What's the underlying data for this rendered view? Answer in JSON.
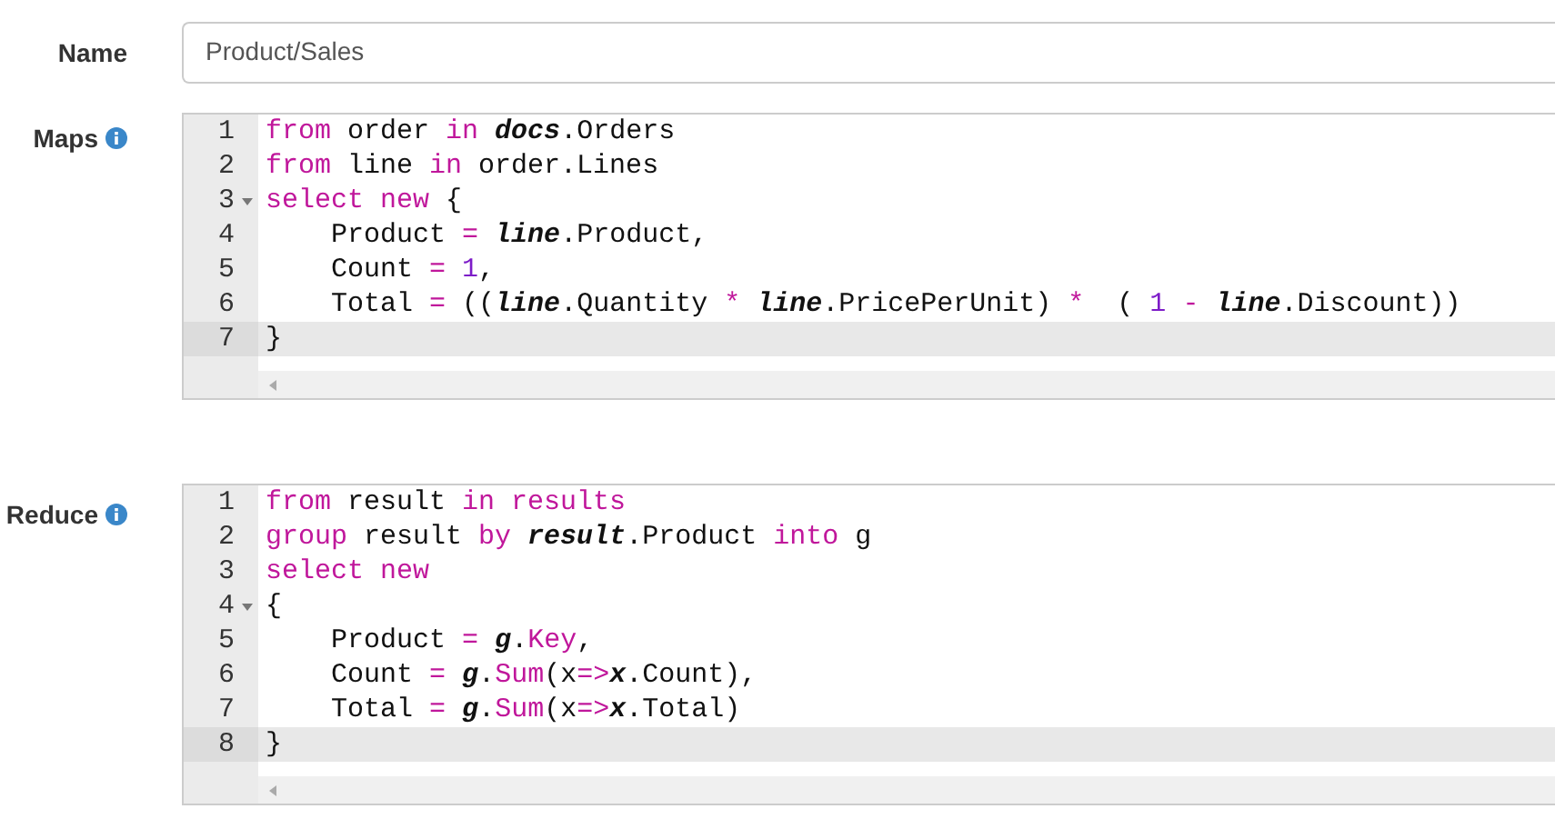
{
  "name_field": {
    "label": "Name",
    "value": "Product/Sales"
  },
  "editors": [
    {
      "label": "Maps",
      "lines": [
        {
          "number": "1",
          "fold": false,
          "current": false,
          "tokens": [
            {
              "t": "from",
              "kind": "kw"
            },
            {
              "t": " order ",
              "kind": "text"
            },
            {
              "t": "in ",
              "kind": "kw"
            },
            {
              "t": "docs",
              "kind": "var"
            },
            {
              "t": ".Orders",
              "kind": "text"
            }
          ]
        },
        {
          "number": "2",
          "fold": false,
          "current": false,
          "tokens": [
            {
              "t": "from",
              "kind": "kw"
            },
            {
              "t": " line ",
              "kind": "text"
            },
            {
              "t": "in",
              "kind": "kw"
            },
            {
              "t": " order.Lines",
              "kind": "text"
            }
          ]
        },
        {
          "number": "3",
          "fold": true,
          "current": false,
          "tokens": [
            {
              "t": "select new",
              "kind": "kw"
            },
            {
              "t": " {",
              "kind": "text"
            }
          ]
        },
        {
          "number": "4",
          "fold": false,
          "current": false,
          "tokens": [
            {
              "t": "    Product ",
              "kind": "text"
            },
            {
              "t": "= ",
              "kind": "op"
            },
            {
              "t": "line",
              "kind": "var"
            },
            {
              "t": ".Product,",
              "kind": "text"
            }
          ]
        },
        {
          "number": "5",
          "fold": false,
          "current": false,
          "tokens": [
            {
              "t": "    Count ",
              "kind": "text"
            },
            {
              "t": "= ",
              "kind": "op"
            },
            {
              "t": "1",
              "kind": "num"
            },
            {
              "t": ",",
              "kind": "text"
            }
          ]
        },
        {
          "number": "6",
          "fold": false,
          "current": false,
          "tokens": [
            {
              "t": "    Total ",
              "kind": "text"
            },
            {
              "t": "=",
              "kind": "op"
            },
            {
              "t": " ((",
              "kind": "text"
            },
            {
              "t": "line",
              "kind": "var"
            },
            {
              "t": ".Quantity ",
              "kind": "text"
            },
            {
              "t": "* ",
              "kind": "op"
            },
            {
              "t": "line",
              "kind": "var"
            },
            {
              "t": ".PricePerUnit) ",
              "kind": "text"
            },
            {
              "t": "*",
              "kind": "op"
            },
            {
              "t": "  ( ",
              "kind": "text"
            },
            {
              "t": "1 ",
              "kind": "num"
            },
            {
              "t": "- ",
              "kind": "op"
            },
            {
              "t": "line",
              "kind": "var"
            },
            {
              "t": ".Discount))",
              "kind": "text"
            }
          ]
        },
        {
          "number": "7",
          "fold": false,
          "current": true,
          "tokens": [
            {
              "t": "}",
              "kind": "text"
            }
          ]
        }
      ]
    },
    {
      "label": "Reduce",
      "lines": [
        {
          "number": "1",
          "fold": false,
          "current": false,
          "tokens": [
            {
              "t": "from",
              "kind": "kw"
            },
            {
              "t": " result ",
              "kind": "text"
            },
            {
              "t": "in results",
              "kind": "kw"
            }
          ]
        },
        {
          "number": "2",
          "fold": false,
          "current": false,
          "tokens": [
            {
              "t": "group",
              "kind": "kw"
            },
            {
              "t": " result ",
              "kind": "text"
            },
            {
              "t": "by ",
              "kind": "kw"
            },
            {
              "t": "result",
              "kind": "var"
            },
            {
              "t": ".Product ",
              "kind": "text"
            },
            {
              "t": "into",
              "kind": "kw"
            },
            {
              "t": " g",
              "kind": "text"
            }
          ]
        },
        {
          "number": "3",
          "fold": false,
          "current": false,
          "tokens": [
            {
              "t": "select new",
              "kind": "kw"
            }
          ]
        },
        {
          "number": "4",
          "fold": true,
          "current": false,
          "tokens": [
            {
              "t": "{",
              "kind": "text"
            }
          ]
        },
        {
          "number": "5",
          "fold": false,
          "current": false,
          "tokens": [
            {
              "t": "    Product ",
              "kind": "text"
            },
            {
              "t": "= ",
              "kind": "op"
            },
            {
              "t": "g",
              "kind": "var"
            },
            {
              "t": ".",
              "kind": "text"
            },
            {
              "t": "Key",
              "kind": "kw"
            },
            {
              "t": ",",
              "kind": "text"
            }
          ]
        },
        {
          "number": "6",
          "fold": false,
          "current": false,
          "tokens": [
            {
              "t": "    Count ",
              "kind": "text"
            },
            {
              "t": "= ",
              "kind": "op"
            },
            {
              "t": "g",
              "kind": "var"
            },
            {
              "t": ".",
              "kind": "text"
            },
            {
              "t": "Sum",
              "kind": "kw"
            },
            {
              "t": "(x",
              "kind": "text"
            },
            {
              "t": "=>",
              "kind": "op"
            },
            {
              "t": "x",
              "kind": "var"
            },
            {
              "t": ".Count),",
              "kind": "text"
            }
          ]
        },
        {
          "number": "7",
          "fold": false,
          "current": false,
          "tokens": [
            {
              "t": "    Total ",
              "kind": "text"
            },
            {
              "t": "= ",
              "kind": "op"
            },
            {
              "t": "g",
              "kind": "var"
            },
            {
              "t": ".",
              "kind": "text"
            },
            {
              "t": "Sum",
              "kind": "kw"
            },
            {
              "t": "(x",
              "kind": "text"
            },
            {
              "t": "=>",
              "kind": "op"
            },
            {
              "t": "x",
              "kind": "var"
            },
            {
              "t": ".Total)",
              "kind": "text"
            }
          ]
        },
        {
          "number": "8",
          "fold": false,
          "current": true,
          "tokens": [
            {
              "t": "}",
              "kind": "text"
            }
          ]
        }
      ]
    }
  ]
}
